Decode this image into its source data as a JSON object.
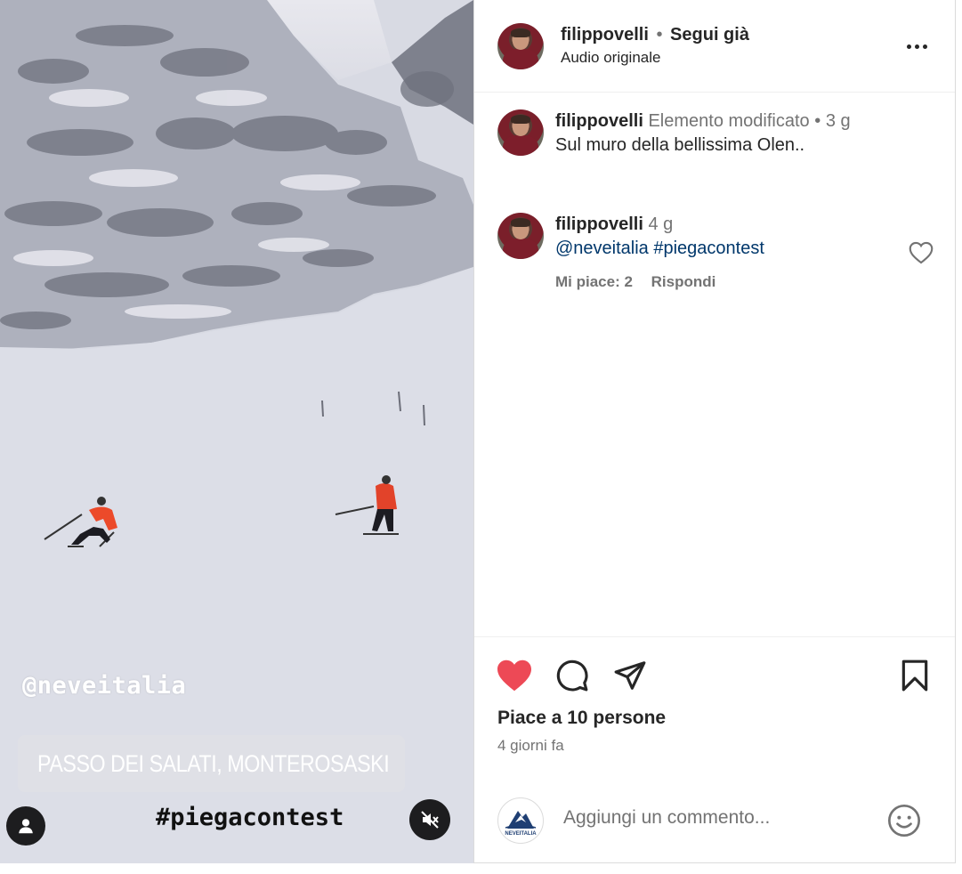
{
  "media": {
    "overlay_mention": "@neveitalia",
    "location": "PASSO DEI SALATI, MONTEROSASKI",
    "overlay_hashtag": "#piegacontest"
  },
  "header": {
    "username": "filippovelli",
    "separator": "•",
    "follow_status": "Segui già",
    "audio": "Audio originale"
  },
  "comments": [
    {
      "username": "filippovelli",
      "meta": "Elemento modificato",
      "separator": "•",
      "time": "3 g",
      "text": "Sul muro della bellissima Olen.."
    },
    {
      "username": "filippovelli",
      "time": "4 g",
      "text": "@neveitalia #piegacontest",
      "likes": "Mi piace: 2",
      "reply": "Rispondi"
    }
  ],
  "actions": {
    "liked": true,
    "like_color": "#ed4956",
    "likes_text": "Piace a 10 persone",
    "date": "4 giorni fa"
  },
  "add_comment": {
    "placeholder": "Aggiungi un commento...",
    "avatar_logo_text": "NEVEITALIA"
  }
}
